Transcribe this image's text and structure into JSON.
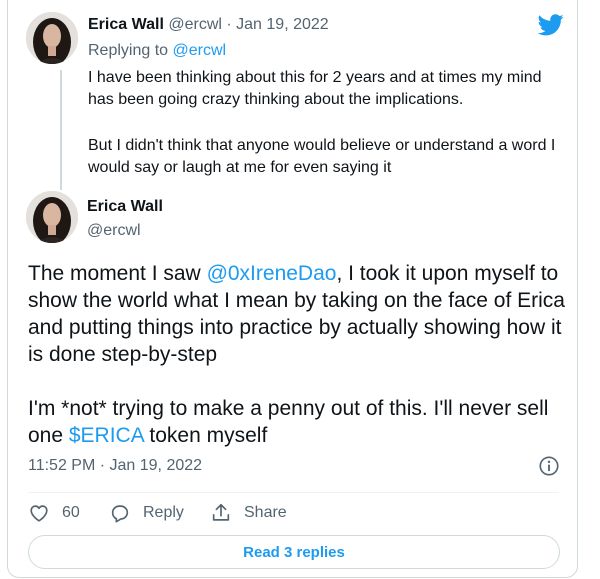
{
  "colors": {
    "accent": "#1d9bf0",
    "text": "#0f1419",
    "muted": "#536471",
    "border": "#cfd9de"
  },
  "parent_tweet": {
    "author_name": "Erica Wall",
    "handle": "@ercwl",
    "separator": "·",
    "date": "Jan 19, 2022",
    "replying_prefix": "Replying to",
    "replying_handle": "@ercwl",
    "paragraphs": [
      "I have been thinking about this for 2 years and at times my mind has been going crazy thinking about the implications.",
      "But I didn't think that anyone would believe or understand a word I would say or laugh at me for even saying it"
    ]
  },
  "main_tweet": {
    "author_name": "Erica Wall",
    "handle": "@ercwl",
    "text_1_before": "The moment I saw ",
    "mention": "@0xIreneDao",
    "text_1_after": ", I took it upon myself to show the world what I mean by taking on the face of Erica and putting things into practice by actually showing how it is done step-by-step",
    "text_2_before": "I'm *not* trying to make a penny out of this. I'll never sell one ",
    "cashtag": "$ERICA",
    "text_2_after": " token myself",
    "timestamp": "11:52 PM · Jan 19, 2022"
  },
  "actions": {
    "like_count": "60",
    "reply_label": "Reply",
    "share_label": "Share"
  },
  "read_replies_label": "Read 3 replies",
  "icons": {
    "brand": "twitter-bird-icon",
    "info": "info-icon",
    "like": "heart-icon",
    "reply": "reply-bubble-icon",
    "share": "share-icon"
  }
}
